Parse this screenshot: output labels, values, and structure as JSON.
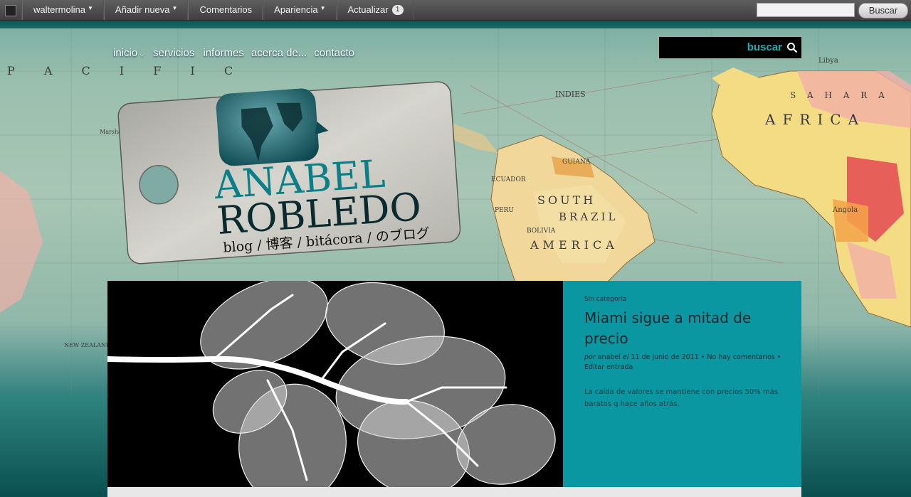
{
  "adminbar": {
    "user": "waltermolina",
    "add_new": "Añadir nueva",
    "comments": "Comentarios",
    "appearance": "Apariencia",
    "update": "Actualizar",
    "update_count": "1",
    "search_button": "Buscar",
    "search_value": ""
  },
  "nav": {
    "items": [
      "inicio",
      "servicios",
      "informes",
      "acerca de...",
      "contacto"
    ]
  },
  "search": {
    "label": "buscar"
  },
  "logo": {
    "name_line1": "ANABEL",
    "name_line2": "ROBLEDO",
    "tagline": "blog / 博客 / bitácora / のブログ"
  },
  "post": {
    "category": "Sin categoría",
    "title": "Miami sigue a mitad de precio",
    "meta_by": "por",
    "meta_author": "anabel",
    "meta_on": "el",
    "meta_date": "11 de junio de 2011",
    "meta_comments": "No hay comentarios",
    "meta_edit": "Editar entrada",
    "excerpt": "La caída de valores se mantiene con precios 50% más baratos q hace años atrás."
  },
  "map_labels": [
    "P A C I F I C",
    "INDIES",
    "SOUTH",
    "BRAZIL",
    "AMERICA",
    "AFRICA",
    "S A H A R A",
    "ECUADOR",
    "GUIANA",
    "BOLIVIA",
    "PERU",
    "Angola",
    "Libya",
    "Marshall",
    "NEW ZEALAND"
  ],
  "colors": {
    "adminbar": "#464646",
    "accent_teal": "#0b97a1",
    "search_label": "#1ab0b0"
  }
}
